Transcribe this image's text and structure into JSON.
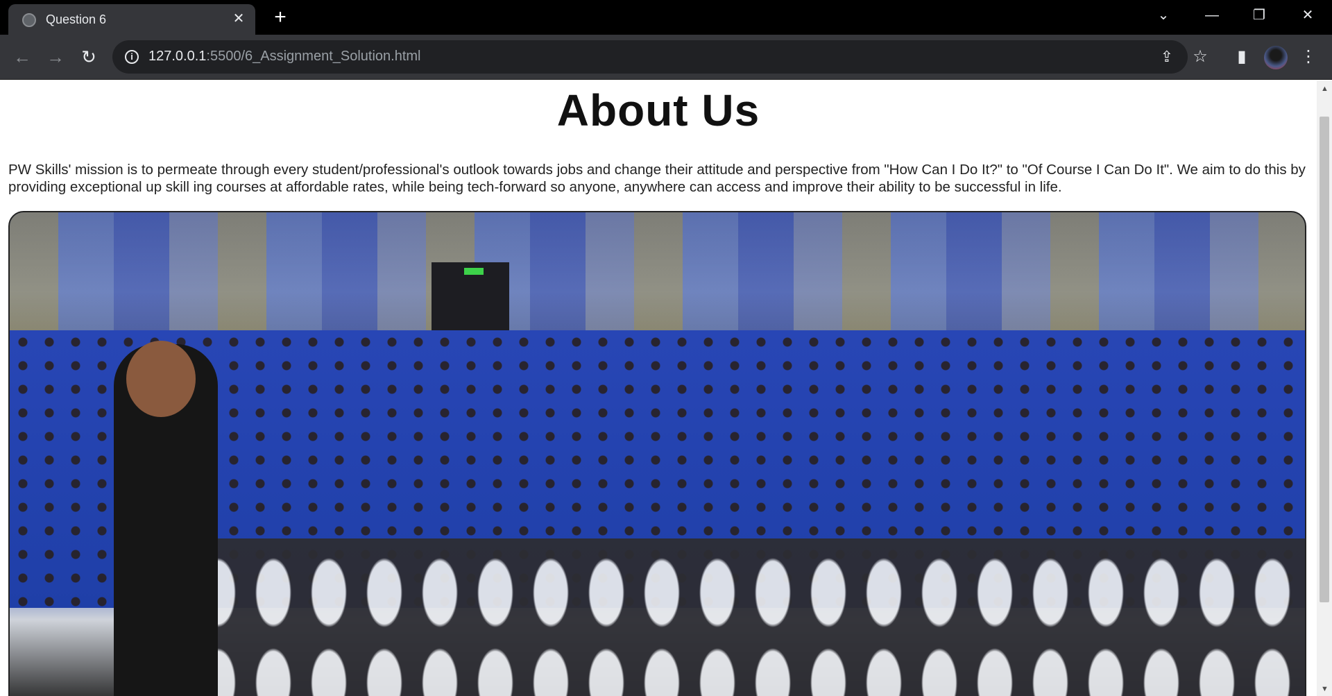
{
  "browser": {
    "tab": {
      "title": "Question 6",
      "favicon": "globe-icon",
      "close": "✕"
    },
    "new_tab": "+",
    "window_controls": {
      "tabs_menu": "⌄",
      "minimize": "—",
      "restore": "❐",
      "close": "✕"
    },
    "toolbar": {
      "back": "←",
      "forward": "→",
      "reload": "↻",
      "info": "i",
      "url_host": "127.0.0.1",
      "url_rest": ":5500/6_Assignment_Solution.html",
      "share": "⇪",
      "bookmark": "☆",
      "side_panel": "▮",
      "menu": "⋮"
    }
  },
  "page": {
    "heading": "About Us",
    "mission": "PW Skills' mission is to permeate through every student/professional's outlook towards jobs and change their attitude and perspective from \"How Can I Do It?\" to \"Of Course I Can Do It\". We aim to do this by providing exceptional up skill ing courses at affordable rates, while being tech-forward so anyone, anywhere can access and improve their ability to be successful in life."
  },
  "scrollbar": {
    "up": "▲",
    "down": "▼"
  }
}
